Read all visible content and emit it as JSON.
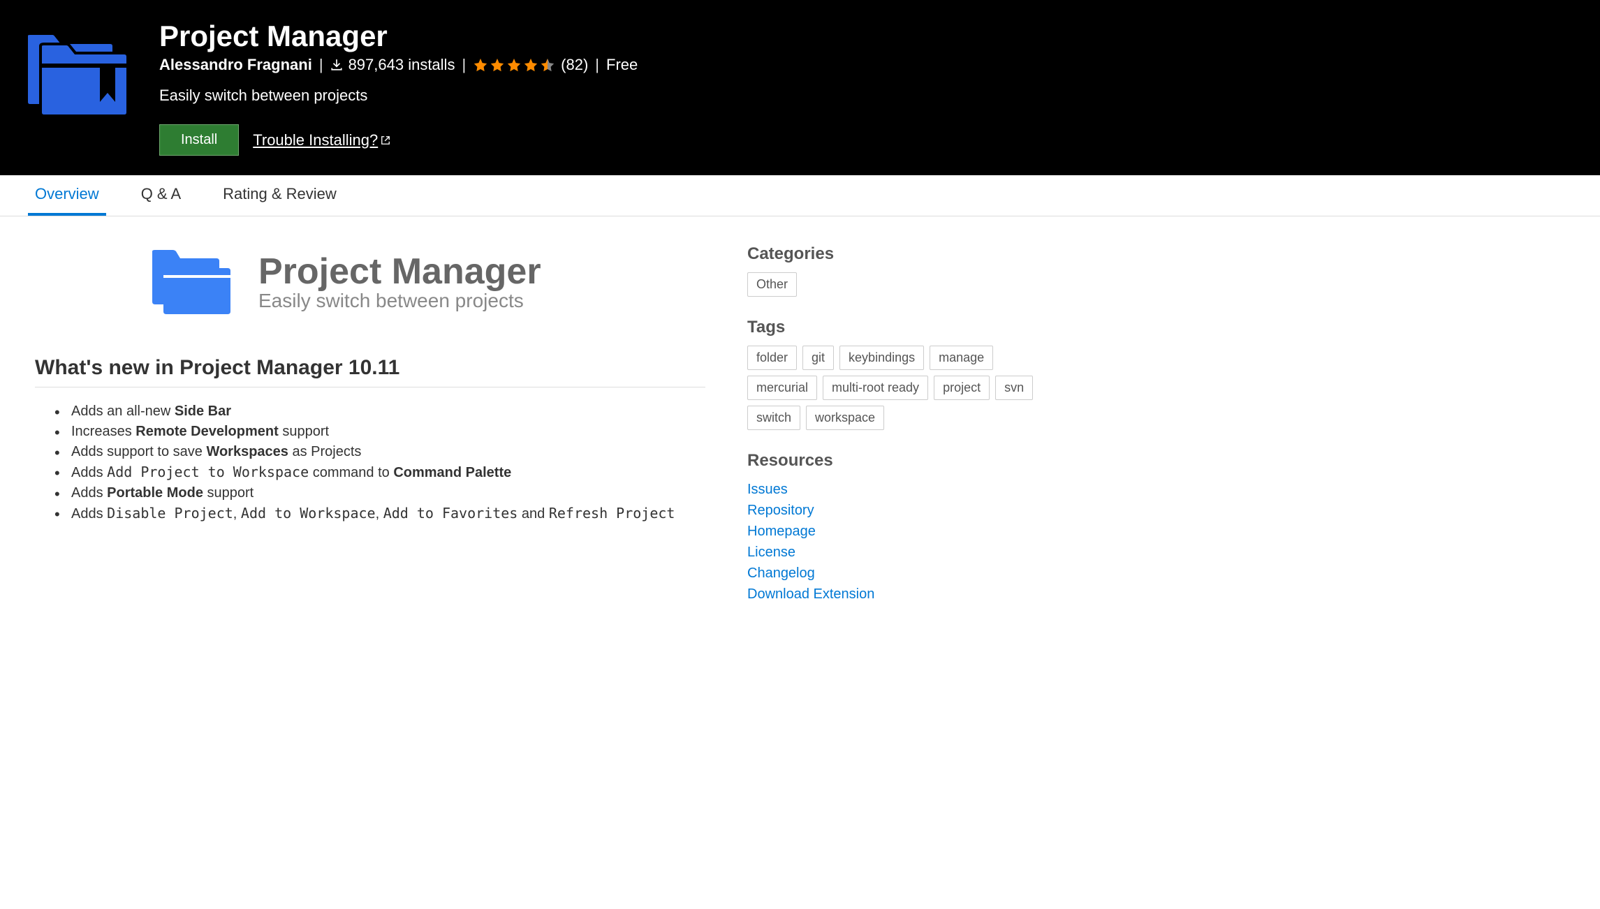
{
  "header": {
    "title": "Project Manager",
    "author": "Alessandro Fragnani",
    "installs": "897,643 installs",
    "rating_count": "(82)",
    "price": "Free",
    "description": "Easily switch between projects",
    "install_label": "Install",
    "trouble_label": "Trouble Installing?"
  },
  "tabs": [
    {
      "id": "overview",
      "label": "Overview",
      "active": true
    },
    {
      "id": "qa",
      "label": "Q & A",
      "active": false
    },
    {
      "id": "rating",
      "label": "Rating & Review",
      "active": false
    }
  ],
  "banner": {
    "title": "Project Manager",
    "subtitle": "Easily switch between projects"
  },
  "whats_new": {
    "title": "What's new in Project Manager 10.11",
    "items": [
      {
        "html": "Adds an all-new <b>Side Bar</b>"
      },
      {
        "html": "Increases <b>Remote Development</b> support"
      },
      {
        "html": "Adds support to save <b>Workspaces</b> as Projects"
      },
      {
        "html": "Adds <code>Add Project to Workspace</code> command to <b>Command Palette</b>"
      },
      {
        "html": "Adds <b>Portable Mode</b> support"
      },
      {
        "html": "Adds <code>Disable Project</code>, <code>Add to Workspace</code>, <code>Add to Favorites</code> and <code>Refresh Project</code>"
      }
    ]
  },
  "sidebar": {
    "categories_heading": "Categories",
    "categories": [
      "Other"
    ],
    "tags_heading": "Tags",
    "tags": [
      "folder",
      "git",
      "keybindings",
      "manage",
      "mercurial",
      "multi-root ready",
      "project",
      "svn",
      "switch",
      "workspace"
    ],
    "resources_heading": "Resources",
    "resources": [
      "Issues",
      "Repository",
      "Homepage",
      "License",
      "Changelog",
      "Download Extension"
    ]
  }
}
